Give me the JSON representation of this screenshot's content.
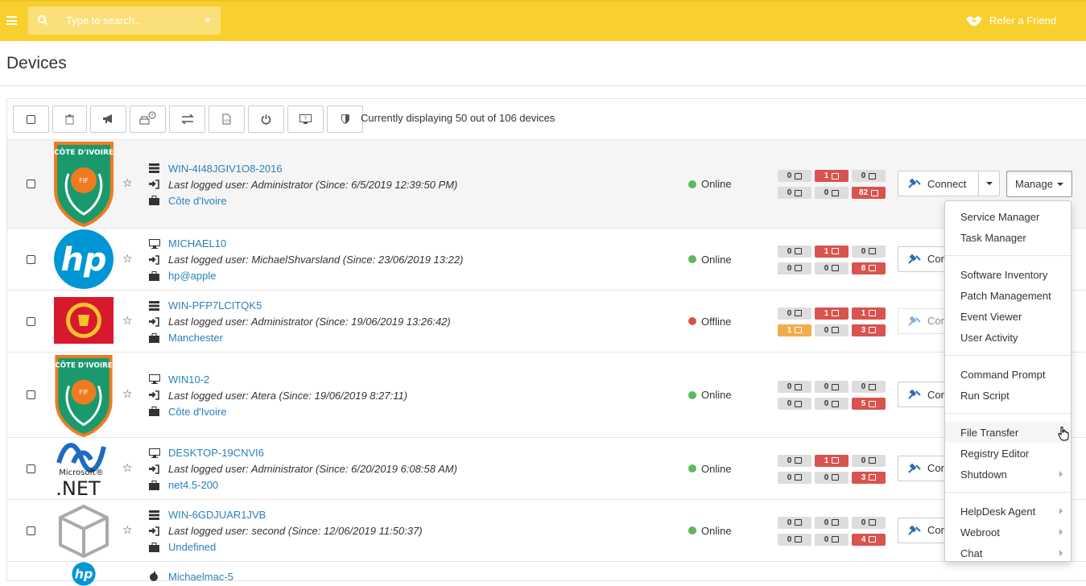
{
  "header": {
    "search_placeholder": "Type to search..",
    "refer_label": "Refer a Friend",
    "accent_color": "#f8d02e"
  },
  "page": {
    "title": "Devices",
    "display_text": "Currently displaying 50 out of 106 devices"
  },
  "toolbar": [
    "select-all-checkbox",
    "trash-icon",
    "megaphone-icon",
    "printer-alert-icon",
    "transfer-icon",
    "script-icon",
    "power-icon",
    "monitor-icon",
    "shield-icon"
  ],
  "connect_label": "Connect",
  "manage_label": "Manage",
  "devices": [
    {
      "name": "WIN-4I48JGIV1O8-2016",
      "device_icon": "server-icon",
      "user_text": "Last logged user: Administrator (Since: 6/5/2019 12:39:50 PM)",
      "customer": "Côte d'Ivoire",
      "status": "Online",
      "logo": "cote-divoire-logo",
      "badges": [
        {
          "v": "0",
          "c": "g",
          "i": "building"
        },
        {
          "v": "1",
          "c": "r",
          "i": "printer"
        },
        {
          "v": "0",
          "c": "g",
          "i": "heart"
        },
        {
          "v": "0",
          "c": "g",
          "i": "chart"
        },
        {
          "v": "0",
          "c": "g",
          "i": "mail"
        },
        {
          "v": "82",
          "c": "r",
          "i": "grid"
        }
      ]
    },
    {
      "name": "MICHAEL10",
      "device_icon": "desktop-icon",
      "user_text": "Last logged user: MichaelShvarsland (Since: 23/06/2019 13:22)",
      "customer": "hp@apple",
      "status": "Online",
      "logo": "hp-logo",
      "badges": [
        {
          "v": "0",
          "c": "g",
          "i": "building"
        },
        {
          "v": "1",
          "c": "r",
          "i": "printer"
        },
        {
          "v": "0",
          "c": "g",
          "i": "heart"
        },
        {
          "v": "0",
          "c": "g",
          "i": "chart"
        },
        {
          "v": "0",
          "c": "g",
          "i": "mail"
        },
        {
          "v": "8",
          "c": "r",
          "i": "grid"
        }
      ]
    },
    {
      "name": "WIN-PFP7LCITQK5",
      "device_icon": "server-icon",
      "user_text": "Last logged user: Administrator (Since: 19/06/2019 13:26:42)",
      "customer": "Manchester",
      "status": "Offline",
      "logo": "manchester-logo",
      "badges": [
        {
          "v": "0",
          "c": "g",
          "i": "building"
        },
        {
          "v": "1",
          "c": "r",
          "i": "printer"
        },
        {
          "v": "1",
          "c": "r",
          "i": "heart"
        },
        {
          "v": "1",
          "c": "o",
          "i": "chart"
        },
        {
          "v": "0",
          "c": "g",
          "i": "mail"
        },
        {
          "v": "3",
          "c": "r",
          "i": "grid"
        }
      ]
    },
    {
      "name": "WIN10-2",
      "device_icon": "desktop-icon",
      "user_text": "Last logged user: Atera (Since: 19/06/2019 8:27:11)",
      "customer": "Côte d'Ivoire",
      "status": "Online",
      "logo": "cote-divoire-logo",
      "badges": [
        {
          "v": "0",
          "c": "g",
          "i": "building"
        },
        {
          "v": "0",
          "c": "g",
          "i": "printer"
        },
        {
          "v": "0",
          "c": "g",
          "i": "heart"
        },
        {
          "v": "0",
          "c": "g",
          "i": "chart"
        },
        {
          "v": "0",
          "c": "g",
          "i": "mail"
        },
        {
          "v": "5",
          "c": "r",
          "i": "grid"
        }
      ]
    },
    {
      "name": "DESKTOP-19CNVI6",
      "device_icon": "desktop-icon",
      "user_text": "Last logged user: Administrator (Since: 6/20/2019 6:08:58 AM)",
      "customer": "net4.5-200",
      "status": "Online",
      "logo": "dotnet-logo",
      "badges": [
        {
          "v": "0",
          "c": "g",
          "i": "building"
        },
        {
          "v": "1",
          "c": "r",
          "i": "printer"
        },
        {
          "v": "0",
          "c": "g",
          "i": "heart"
        },
        {
          "v": "0",
          "c": "g",
          "i": "chart"
        },
        {
          "v": "0",
          "c": "g",
          "i": "mail"
        },
        {
          "v": "3",
          "c": "r",
          "i": "grid"
        }
      ]
    },
    {
      "name": "WIN-6GDJUAR1JVB",
      "device_icon": "server-icon",
      "user_text": "Last logged user: second (Since: 12/06/2019 11:50:37)",
      "customer": "Undefined",
      "status": "Online",
      "logo": "cube-logo",
      "badges": [
        {
          "v": "0",
          "c": "g",
          "i": "building"
        },
        {
          "v": "0",
          "c": "g",
          "i": "printer"
        },
        {
          "v": "0",
          "c": "g",
          "i": "heart"
        },
        {
          "v": "0",
          "c": "g",
          "i": "chart"
        },
        {
          "v": "0",
          "c": "g",
          "i": "mail"
        },
        {
          "v": "4",
          "c": "r",
          "i": "grid"
        }
      ]
    },
    {
      "name": "Michaelmac-5",
      "device_icon": "apple-icon",
      "user_text": "",
      "customer": "",
      "status": "",
      "logo": "hp-logo",
      "badges": []
    }
  ],
  "manage_menu": [
    [
      {
        "label": "Service Manager"
      },
      {
        "label": "Task Manager"
      }
    ],
    [
      {
        "label": "Software Inventory"
      },
      {
        "label": "Patch Management"
      },
      {
        "label": "Event Viewer"
      },
      {
        "label": "User Activity"
      }
    ],
    [
      {
        "label": "Command Prompt"
      },
      {
        "label": "Run Script"
      }
    ],
    [
      {
        "label": "File Transfer",
        "hover": true
      },
      {
        "label": "Registry Editor"
      },
      {
        "label": "Shutdown",
        "sub": true
      }
    ],
    [
      {
        "label": "HelpDesk Agent",
        "sub": true
      },
      {
        "label": "Webroot",
        "sub": true
      },
      {
        "label": "Chat",
        "sub": true
      }
    ]
  ]
}
